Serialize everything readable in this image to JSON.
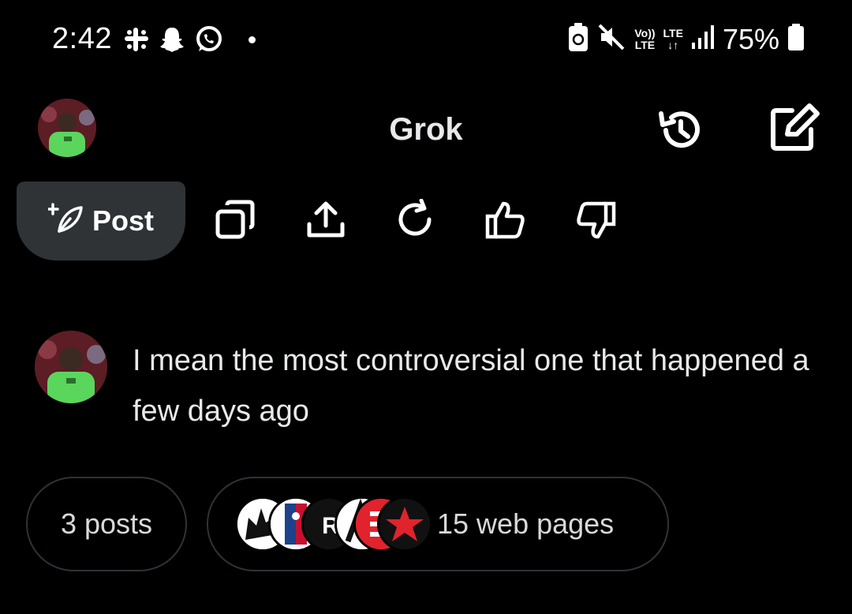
{
  "status_bar": {
    "time": "2:42",
    "network_top": "Vo))",
    "network_bottom": "LTE",
    "lte_top": "LTE",
    "lte_bottom": "↓↑",
    "battery_percent": "75%"
  },
  "header": {
    "title": "Grok"
  },
  "actions": {
    "post_label": "Post"
  },
  "conversation": {
    "user_message": "I mean the most controversial one that happened a few days ago"
  },
  "sources": {
    "posts_label": "3 posts",
    "web_label": "15 web pages"
  },
  "colors": {
    "background": "#000000",
    "pill_background": "#2f3336",
    "text": "#e7e9ea"
  }
}
